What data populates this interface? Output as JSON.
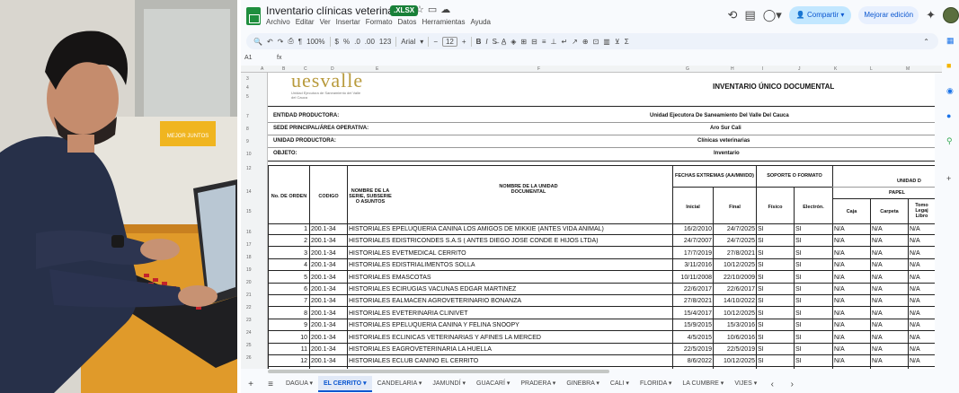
{
  "app": {
    "doc_title": "Inventario clínicas veterinarias",
    "file_badge": ".XLSX",
    "menus": [
      "Archivo",
      "Editar",
      "Ver",
      "Insertar",
      "Formato",
      "Datos",
      "Herramientas",
      "Ayuda"
    ],
    "share_label": "Compartir",
    "improve_label": "Mejorar edición",
    "accent": "#0b57d0"
  },
  "toolbar": {
    "zoom": "100%",
    "currency": "$",
    "percent": "%",
    "dec_less": ".0",
    "dec_more": ".00",
    "number_format": "123",
    "font": "Arial",
    "minus": "−",
    "font_size": "12",
    "plus": "+",
    "bold": "B",
    "italic": "I"
  },
  "formula": {
    "cell_ref": "A1",
    "fx": "fx"
  },
  "document": {
    "logo": "uesvalle",
    "logo_sub": "Unidad Ejecutora de Saneamiento del Valle del Cauca",
    "heading": "INVENTARIO ÚNICO DOCUMENTAL",
    "meta": [
      {
        "label": "ENTIDAD PRODUCTORA:",
        "value": "Unidad Ejecutora De Saneamiento Del Valle Del Cauca"
      },
      {
        "label": "SEDE PRINCIPAL/ÁREA OPERATIVA:",
        "value": "Aro Sur Cali"
      },
      {
        "label": "UNIDAD PRODUCTORA:",
        "value": "Clínicas veterinarias"
      },
      {
        "label": "OBJETO:",
        "value": "Inventario"
      }
    ],
    "headers": {
      "orden": "No. DE ORDEN",
      "codigo": "CODIGO",
      "serie": "NOMBRE DE LA SERIE, SUBSERIE O ASUNTOS",
      "unidad": "NOMBRE DE LA UNIDAD DOCUMENTAL",
      "fechas": "FECHAS EXTREMAS (AA/MM/DD)",
      "inicial": "Inicial",
      "final": "Final",
      "soporte": "SOPORTE O FORMATO",
      "fisico": "Físico",
      "electron": "Electrón.",
      "unidad_d": "UNIDAD D",
      "papel": "PAPEL",
      "caja": "Caja",
      "carpeta": "Carpeta",
      "tomo": "Tomo Legaj Libro"
    },
    "rows": [
      {
        "n": "1",
        "code": "200.1-34",
        "name": "HISTORIALES EPELUQUERIA CANINA LOS AMIGOS DE MIKKIE (ANTES VIDA ANIMAL)",
        "ini": "16/2/2010",
        "fin": "24/7/2025",
        "fis": "SI",
        "ele": "SI",
        "caja": "N/A",
        "carp": "N/A",
        "tomo": "N/A"
      },
      {
        "n": "2",
        "code": "200.1-34",
        "name": "HISTORIALES EDISTRICONDES S.A.S ( ANTES DIEGO JOSÉ CONDE E HIJOS LTDA)",
        "ini": "24/7/2007",
        "fin": "24/7/2025",
        "fis": "SI",
        "ele": "SI",
        "caja": "N/A",
        "carp": "N/A",
        "tomo": "N/A"
      },
      {
        "n": "3",
        "code": "200.1-34",
        "name": "HISTORIALES EVETMEDICAL CERRITO",
        "ini": "17/7/2019",
        "fin": "27/8/2021",
        "fis": "SI",
        "ele": "SI",
        "caja": "N/A",
        "carp": "N/A",
        "tomo": "N/A"
      },
      {
        "n": "4",
        "code": "200.1-34",
        "name": "HISTORIALES EDISTRIALIMENTOS SOLLA",
        "ini": "3/11/2016",
        "fin": "10/12/2025",
        "fis": "SI",
        "ele": "SI",
        "caja": "N/A",
        "carp": "N/A",
        "tomo": "N/A"
      },
      {
        "n": "5",
        "code": "200.1-34",
        "name": "HISTORIALES EMASCOTAS",
        "ini": "10/11/2008",
        "fin": "22/10/2009",
        "fis": "SI",
        "ele": "SI",
        "caja": "N/A",
        "carp": "N/A",
        "tomo": "N/A"
      },
      {
        "n": "6",
        "code": "200.1-34",
        "name": "HISTORIALES ECIRUGÍAS VACUNAS EDGAR MARTÍNEZ",
        "ini": "22/6/2017",
        "fin": "22/6/2017",
        "fis": "SI",
        "ele": "SI",
        "caja": "N/A",
        "carp": "N/A",
        "tomo": "N/A"
      },
      {
        "n": "7",
        "code": "200.1-34",
        "name": "HISTORIALES EALMACÉN AGROVETERINARIO BONANZA",
        "ini": "27/8/2021",
        "fin": "14/10/2022",
        "fis": "SI",
        "ele": "SI",
        "caja": "N/A",
        "carp": "N/A",
        "tomo": "N/A"
      },
      {
        "n": "8",
        "code": "200.1-34",
        "name": "HISTORIALES EVETERINARIA CLINIVET",
        "ini": "15/4/2017",
        "fin": "10/12/2025",
        "fis": "SI",
        "ele": "SI",
        "caja": "N/A",
        "carp": "N/A",
        "tomo": "N/A"
      },
      {
        "n": "9",
        "code": "200.1-34",
        "name": "HISTORIALES EPELUQUERÍA CANINA Y FELINA SNOOPY",
        "ini": "15/9/2015",
        "fin": "15/3/2016",
        "fis": "SI",
        "ele": "SI",
        "caja": "N/A",
        "carp": "N/A",
        "tomo": "N/A"
      },
      {
        "n": "10",
        "code": "200.1-34",
        "name": "HISTORIALES ECLÍNICAS VETERINARIAS Y AFINES LA MERCED",
        "ini": "4/5/2015",
        "fin": "10/6/2016",
        "fis": "SI",
        "ele": "SI",
        "caja": "N/A",
        "carp": "N/A",
        "tomo": "N/A"
      },
      {
        "n": "11",
        "code": "200.1-34",
        "name": "HISTORIALES EAGROVETERINARIA LA HUELLA",
        "ini": "22/5/2019",
        "fin": "22/5/2019",
        "fis": "SI",
        "ele": "SI",
        "caja": "N/A",
        "carp": "N/A",
        "tomo": "N/A"
      },
      {
        "n": "12",
        "code": "200.1-34",
        "name": "HISTORIALES ECLUB CANINO EL CERRITO",
        "ini": "8/6/2022",
        "fin": "10/12/2025",
        "fis": "SI",
        "ele": "SI",
        "caja": "N/A",
        "carp": "N/A",
        "tomo": "N/A"
      }
    ]
  },
  "sheet_tabs": [
    "DAGUA",
    "EL CERRITO",
    "CANDELARIA",
    "JAMUNDÍ",
    "GUACARÍ",
    "PRADERA",
    "GINEBRA",
    "CALI",
    "FLORIDA",
    "LA CUMBRE",
    "VIJES"
  ],
  "active_tab": "EL CERRITO",
  "photo": {
    "sign_text": "MEJOR JUNTOS"
  }
}
